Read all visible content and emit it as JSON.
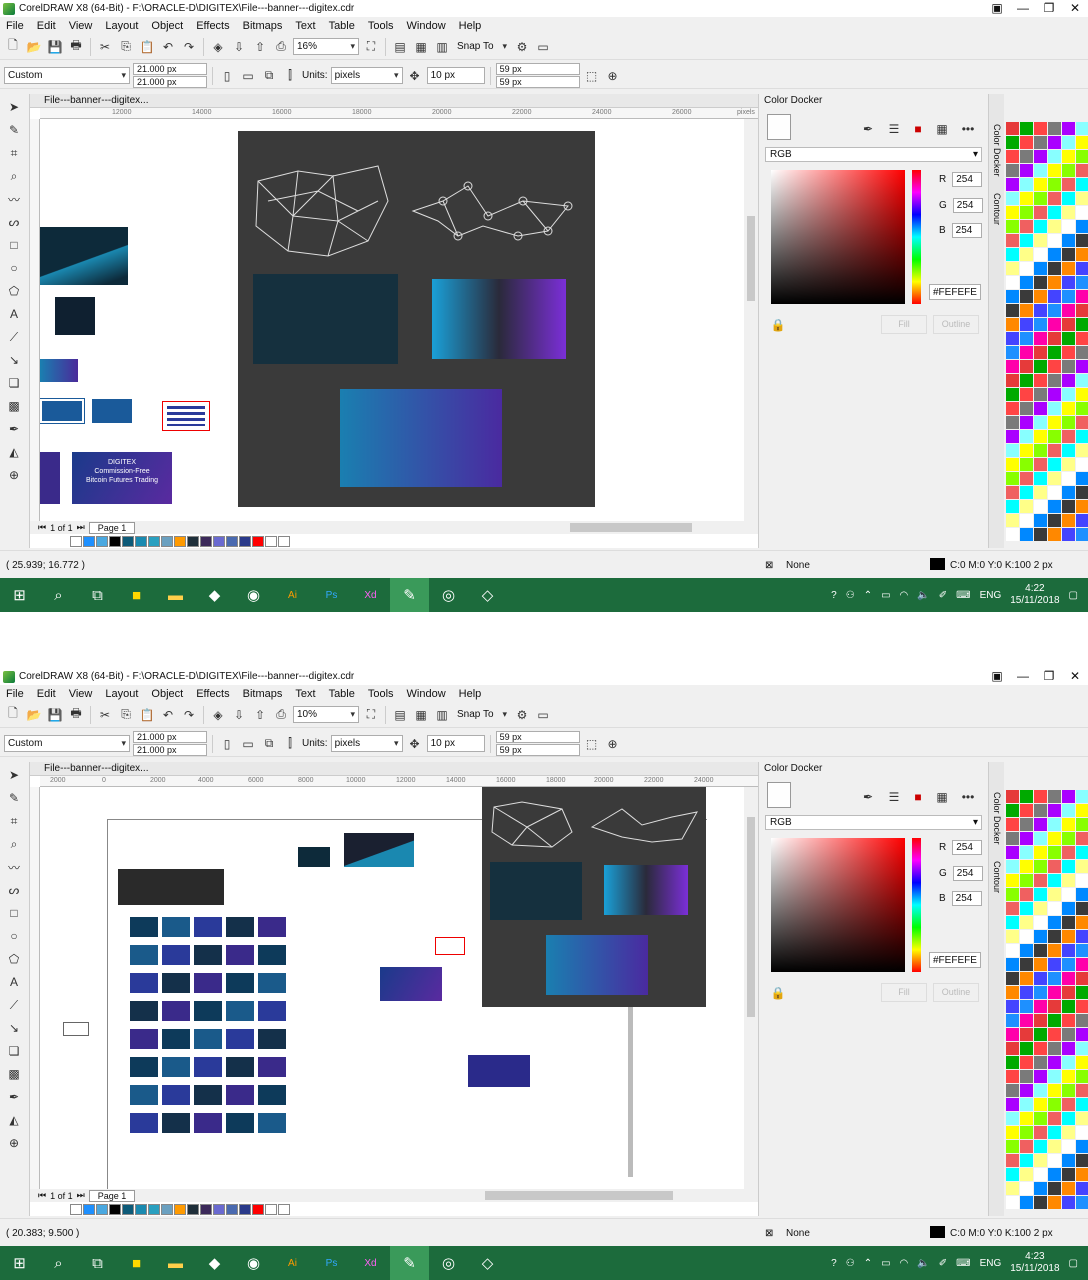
{
  "shots": [
    {
      "title": "CorelDRAW X8 (64-Bit) - F:\\ORACLE-D\\DIGITEX\\File---banner---digitex.cdr",
      "menu": [
        "File",
        "Edit",
        "View",
        "Layout",
        "Object",
        "Effects",
        "Bitmaps",
        "Text",
        "Table",
        "Tools",
        "Window",
        "Help"
      ],
      "zoom": "16%",
      "snap_to": "Snap To",
      "page_size": "Custom",
      "width": "21.000 px",
      "height": "21.000 px",
      "units_label": "Units:",
      "units": "pixels",
      "nudge": "10 px",
      "dup_x": "59 px",
      "dup_y": "59 px",
      "doc_tab": "File---banner---digitex...",
      "ruler_h": [
        "12000",
        "14000",
        "16000",
        "18000",
        "20000",
        "22000",
        "24000",
        "26000",
        "pixels"
      ],
      "page_nav": "1 of 1",
      "page_tab": "Page 1",
      "status_coords": "( 25.939; 16.772 )",
      "fill_status": "None",
      "outline_status": "C:0 M:0 Y:0 K:100  2 px",
      "clock_time": "4:22",
      "clock_date": "15/11/2018",
      "lang": "ENG"
    },
    {
      "title": "CorelDRAW X8 (64-Bit) - F:\\ORACLE-D\\DIGITEX\\File---banner---digitex.cdr",
      "menu": [
        "File",
        "Edit",
        "View",
        "Layout",
        "Object",
        "Effects",
        "Bitmaps",
        "Text",
        "Table",
        "Tools",
        "Window",
        "Help"
      ],
      "zoom": "10%",
      "snap_to": "Snap To",
      "page_size": "Custom",
      "width": "21.000 px",
      "height": "21.000 px",
      "units_label": "Units:",
      "units": "pixels",
      "nudge": "10 px",
      "dup_x": "59 px",
      "dup_y": "59 px",
      "doc_tab": "File---banner---digitex...",
      "ruler_h": [
        "2000",
        "0",
        "2000",
        "4000",
        "6000",
        "8000",
        "10000",
        "12000",
        "14000",
        "16000",
        "18000",
        "20000",
        "22000",
        "24000"
      ],
      "page_nav": "1 of 1",
      "page_tab": "Page 1",
      "status_coords": "( 20.383; 9.500 )",
      "fill_status": "None",
      "outline_status": "C:0 M:0 Y:0 K:100  2 px",
      "clock_time": "4:23",
      "clock_date": "15/11/2018",
      "lang": "ENG"
    }
  ],
  "docker": {
    "title": "Color Docker",
    "model": "RGB",
    "r_label": "R",
    "r": "254",
    "g_label": "G",
    "g": "254",
    "b_label": "B",
    "b": "254",
    "hex": "#FEFEFE",
    "fill_btn": "Fill",
    "outline_btn": "Outline",
    "tab_color": "Color Docker",
    "tab_contour": "Contour"
  },
  "banner_text": [
    "DIGITEX",
    "Commission-Free",
    "Bitcoin Futures Trading"
  ],
  "colors": {
    "taskbar": "#1c6b3c",
    "artboard": "#3a3a3a",
    "banner_dark": "#0e2a3a",
    "gradient_start": "#1aa0d8",
    "gradient_end": "#7b2fd8"
  },
  "bottom_palette": [
    "#ffffff",
    "#1e90ff",
    "#4aa8e0",
    "#000000",
    "#0d5a78",
    "#1a8ab0",
    "#2aa0c0",
    "#6aa0c0",
    "#ff9a00",
    "#1f2f3a",
    "#3c2a5a",
    "#6a6ad0",
    "#4a6ab0",
    "#2a3a8a",
    "#ff0000",
    "#ffffff",
    "#ffffff"
  ]
}
